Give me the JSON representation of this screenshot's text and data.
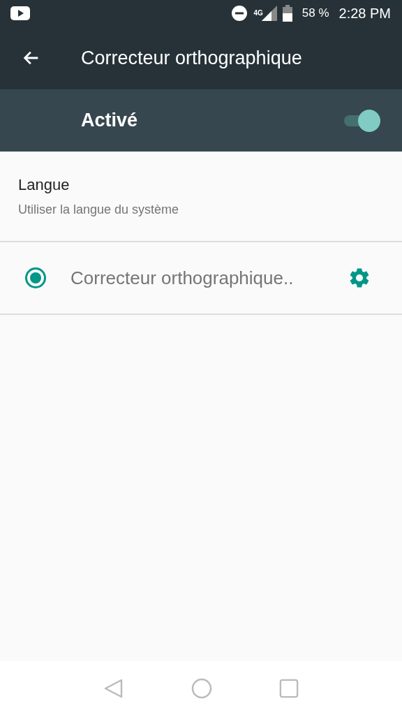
{
  "status_bar": {
    "network": "4G",
    "battery": "58 %",
    "time": "2:28 PM"
  },
  "toolbar": {
    "title": "Correcteur orthographique"
  },
  "master_switch": {
    "label": "Activé",
    "on": true
  },
  "language": {
    "title": "Langue",
    "summary": "Utiliser la langue du système"
  },
  "checkers": [
    {
      "label": "Correcteur orthographique..",
      "selected": true
    }
  ]
}
